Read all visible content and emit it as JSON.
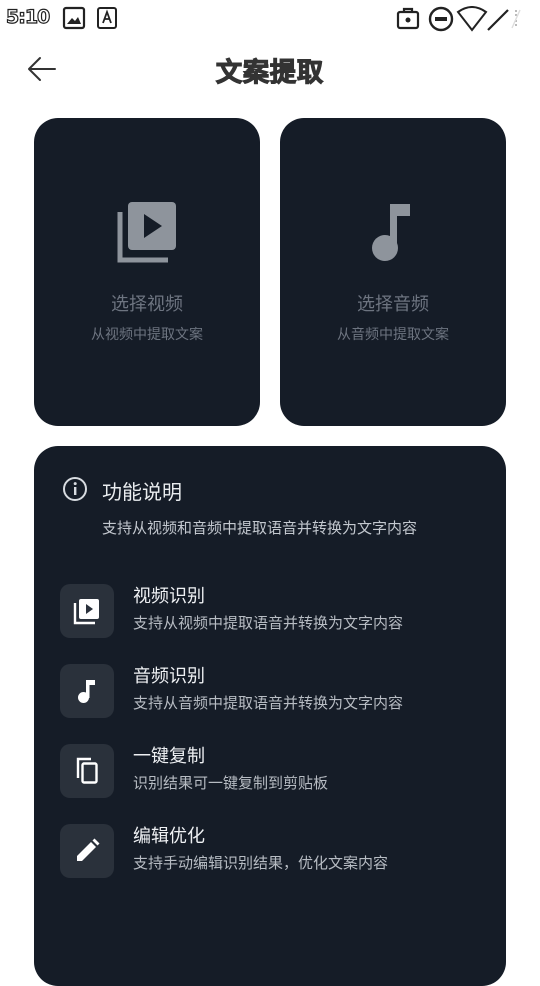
{
  "status_bar": {
    "time": "5:10",
    "icons": [
      "gallery-icon",
      "font-icon",
      "bag-icon",
      "dnd-icon",
      "wifi-icon",
      "signal-icon"
    ]
  },
  "header": {
    "title": "文案提取",
    "back_icon": "arrow-left-icon"
  },
  "pick_cards": [
    {
      "title": "选择视频",
      "subtitle": "从视频中提取文案",
      "icon": "video-library-icon"
    },
    {
      "title": "选择音频",
      "subtitle": "从音频中提取文案",
      "icon": "music-note-icon"
    }
  ],
  "features": {
    "title": "功能说明",
    "icon": "info-icon",
    "description": "支持从视频和音频中提取语音并转换为文字内容",
    "items": [
      {
        "title": "视频识别",
        "desc": "支持从视频中提取语音并转换为文字内容",
        "icon": "video-icon"
      },
      {
        "title": "音频识别",
        "desc": "支持从音频中提取语音并转换为文字内容",
        "icon": "music-note-icon"
      },
      {
        "title": "一键复制",
        "desc": "识别结果可一键复制到剪贴板",
        "icon": "copy-icon"
      },
      {
        "title": "编辑优化",
        "desc": "支持手动编辑识别结果，优化文案内容",
        "icon": "edit-icon"
      }
    ]
  },
  "colors": {
    "card_bg": "#151c27",
    "icon_tile_bg": "#2a313b",
    "muted_text": "#6d7480",
    "page_bg": "#ffffff"
  }
}
